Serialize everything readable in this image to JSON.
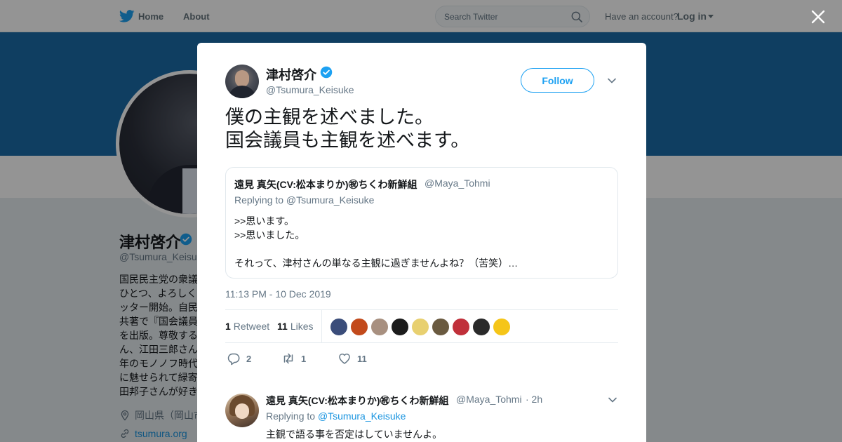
{
  "nav": {
    "home_label": "Home",
    "about_label": "About",
    "search_placeholder": "Search Twitter",
    "have_account": "Have an account?",
    "login_label": "Log in"
  },
  "profile": {
    "name": "津村啓介",
    "handle": "@Tsumura_Keisu",
    "bio_lines": [
      "国民民主党の衆議",
      "ひとつ、よろしく",
      "ッター開始。自民",
      "共著で『国会議員",
      "を出版。尊敬する",
      "ん、江田三郎さん",
      "年のモノノフ時代",
      "に魅せられて緑寄",
      "田邦子さんが好き"
    ],
    "location": "岡山県（岡山市",
    "url": "tsumura.org"
  },
  "tweet": {
    "author_name": "津村啓介",
    "author_handle": "@Tsumura_Keisuke",
    "follow_label": "Follow",
    "text_lines": [
      "僕の主観を述べました。",
      "国会議員も主観を述べます。"
    ],
    "timestamp": "11:13 PM - 10 Dec 2019",
    "retweets_count": "1",
    "retweets_label": "Retweet",
    "likes_count": "11",
    "likes_label": "Likes",
    "reply_action_count": "2",
    "retweet_action_count": "1",
    "like_action_count": "11"
  },
  "quote": {
    "name": "遠見 真矢(CV:松本まりか)㊗ちくわ新鮮組",
    "handle": "@Maya_Tohmi",
    "replying_to": "Replying to @Tsumura_Keisuke",
    "text_lines": [
      ">>思います。",
      ">>思いました。",
      "",
      "それって、津村さんの単なる主観に過ぎませんよね？（苦笑）…"
    ]
  },
  "likers": [
    {
      "name": "liker-1",
      "color": "#3b4d7a"
    },
    {
      "name": "liker-2",
      "color": "#c24a1c"
    },
    {
      "name": "liker-3",
      "color": "#a89080"
    },
    {
      "name": "liker-4",
      "color": "#1c1c1c"
    },
    {
      "name": "liker-5",
      "color": "#e8d070"
    },
    {
      "name": "liker-6",
      "color": "#6a5a40"
    },
    {
      "name": "liker-7",
      "color": "#c0303a"
    },
    {
      "name": "liker-8",
      "color": "#2a2a2a"
    },
    {
      "name": "liker-9",
      "color": "#f5c518"
    }
  ],
  "reply": {
    "name": "遠見 真矢(CV:松本まりか)㊗ちくわ新鮮組",
    "handle": "@Maya_Tohmi",
    "time": "· 2h",
    "replying_prefix": "Replying to",
    "replying_mention": "@Tsumura_Keisuke",
    "text": "主観で語る事を否定はしていませんよ。"
  },
  "colors": {
    "accent": "#1da1f2",
    "link": "#1b95e0",
    "banner": "#1b6ca8",
    "verified": "#1da1f2"
  },
  "icons": [
    "twitter-bird-icon",
    "search-icon",
    "close-icon",
    "verified-icon",
    "chevron-down-icon",
    "reply-icon",
    "retweet-icon",
    "heart-icon",
    "location-icon",
    "link-icon"
  ]
}
